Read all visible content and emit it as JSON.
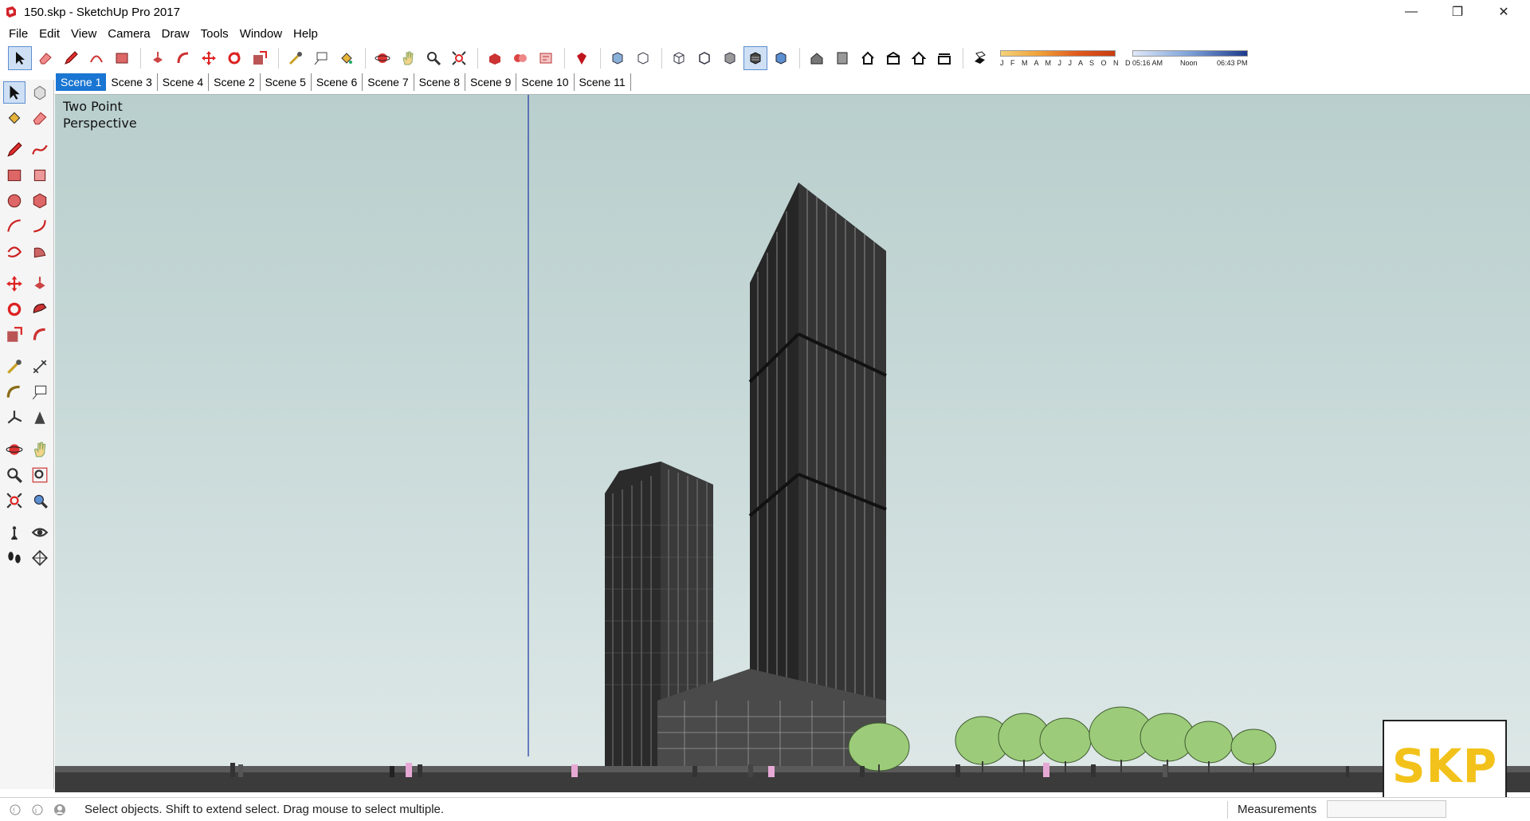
{
  "window": {
    "title": "150.skp - SketchUp Pro 2017",
    "minimize_glyph": "—",
    "maximize_glyph": "❐",
    "close_glyph": "✕"
  },
  "menu": {
    "items": [
      "File",
      "Edit",
      "View",
      "Camera",
      "Draw",
      "Tools",
      "Window",
      "Help"
    ]
  },
  "toolbar": {
    "shadow_months": "J F M A M J J A S O N D",
    "time_start": "05:16 AM",
    "time_mid": "Noon",
    "time_end": "06:43 PM"
  },
  "scenes": {
    "tabs": [
      "Scene 1",
      "Scene 3",
      "Scene 4",
      "Scene 2",
      "Scene 5",
      "Scene 6",
      "Scene 7",
      "Scene 8",
      "Scene 9",
      "Scene 10",
      "Scene 11"
    ],
    "active": "Scene 1"
  },
  "viewport": {
    "camera_label_line1": "Two Point",
    "camera_label_line2": "Perspective"
  },
  "watermark": {
    "text": "SKP"
  },
  "status": {
    "text": "Select objects. Shift to extend select. Drag mouse to select multiple.",
    "measurements_label": "Measurements",
    "measurements_value": ""
  },
  "colors": {
    "sky_top": "#b9cfcd",
    "sky_bottom": "#dee8e7",
    "building": "#2a2a2a",
    "tree": "#9ccc7a",
    "active_tab": "#1976d2",
    "watermark_text": "#f2c21b"
  }
}
